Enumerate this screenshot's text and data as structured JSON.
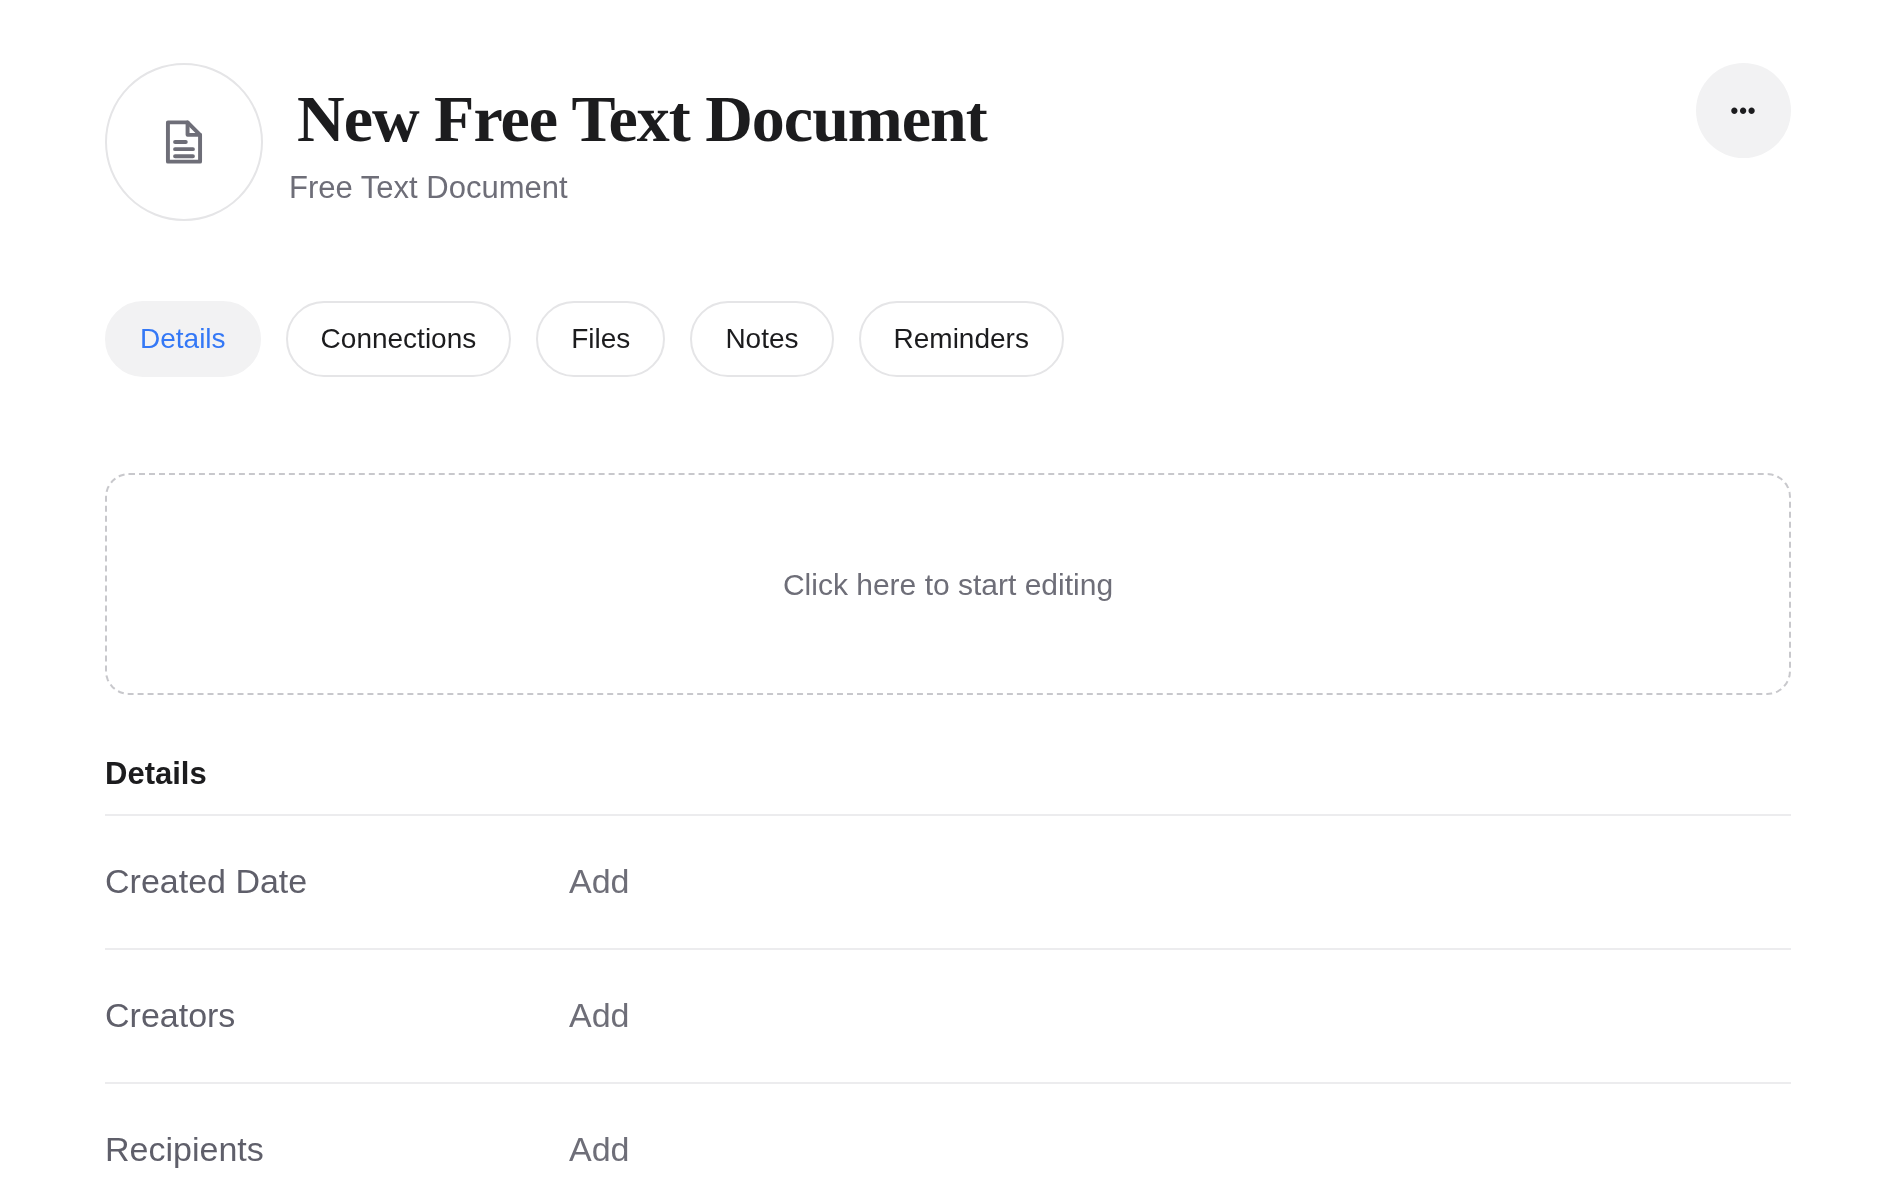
{
  "header": {
    "title": "New Free Text Document",
    "subtitle": "Free Text Document",
    "more_button": "•••"
  },
  "tabs": [
    {
      "label": "Details",
      "selected": true
    },
    {
      "label": "Connections",
      "selected": false
    },
    {
      "label": "Files",
      "selected": false
    },
    {
      "label": "Notes",
      "selected": false
    },
    {
      "label": "Reminders",
      "selected": false
    }
  ],
  "editor": {
    "placeholder": "Click here to start editing"
  },
  "details": {
    "heading": "Details",
    "rows": [
      {
        "label": "Created Date",
        "value": "Add"
      },
      {
        "label": "Creators",
        "value": "Add"
      },
      {
        "label": "Recipients",
        "value": "Add"
      }
    ]
  }
}
